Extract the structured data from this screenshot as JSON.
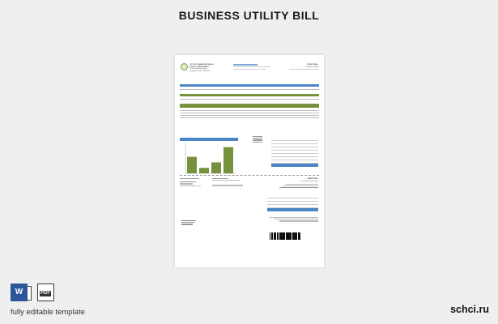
{
  "page": {
    "title": "BUSINESS UTILITY BILL",
    "caption": "fully editable template",
    "brand": "schci.ru",
    "icons": {
      "word": "W",
      "pdf": "PDF"
    }
  },
  "bill": {
    "header_left": [
      "CITY OF PINEGROVE FALLS",
      "UTILITY DEPARTMENT",
      "1234 South Street Ave",
      "Pinegrove Falls, CA 1234"
    ],
    "header_right_title": "UTILITY BILL",
    "header_right_sub": "Customer Copy",
    "section_credit": "CREDIT BILL",
    "chart_title": "Consumption History",
    "bar_values": [
      0.6,
      0.2,
      0.4,
      0.95
    ]
  }
}
